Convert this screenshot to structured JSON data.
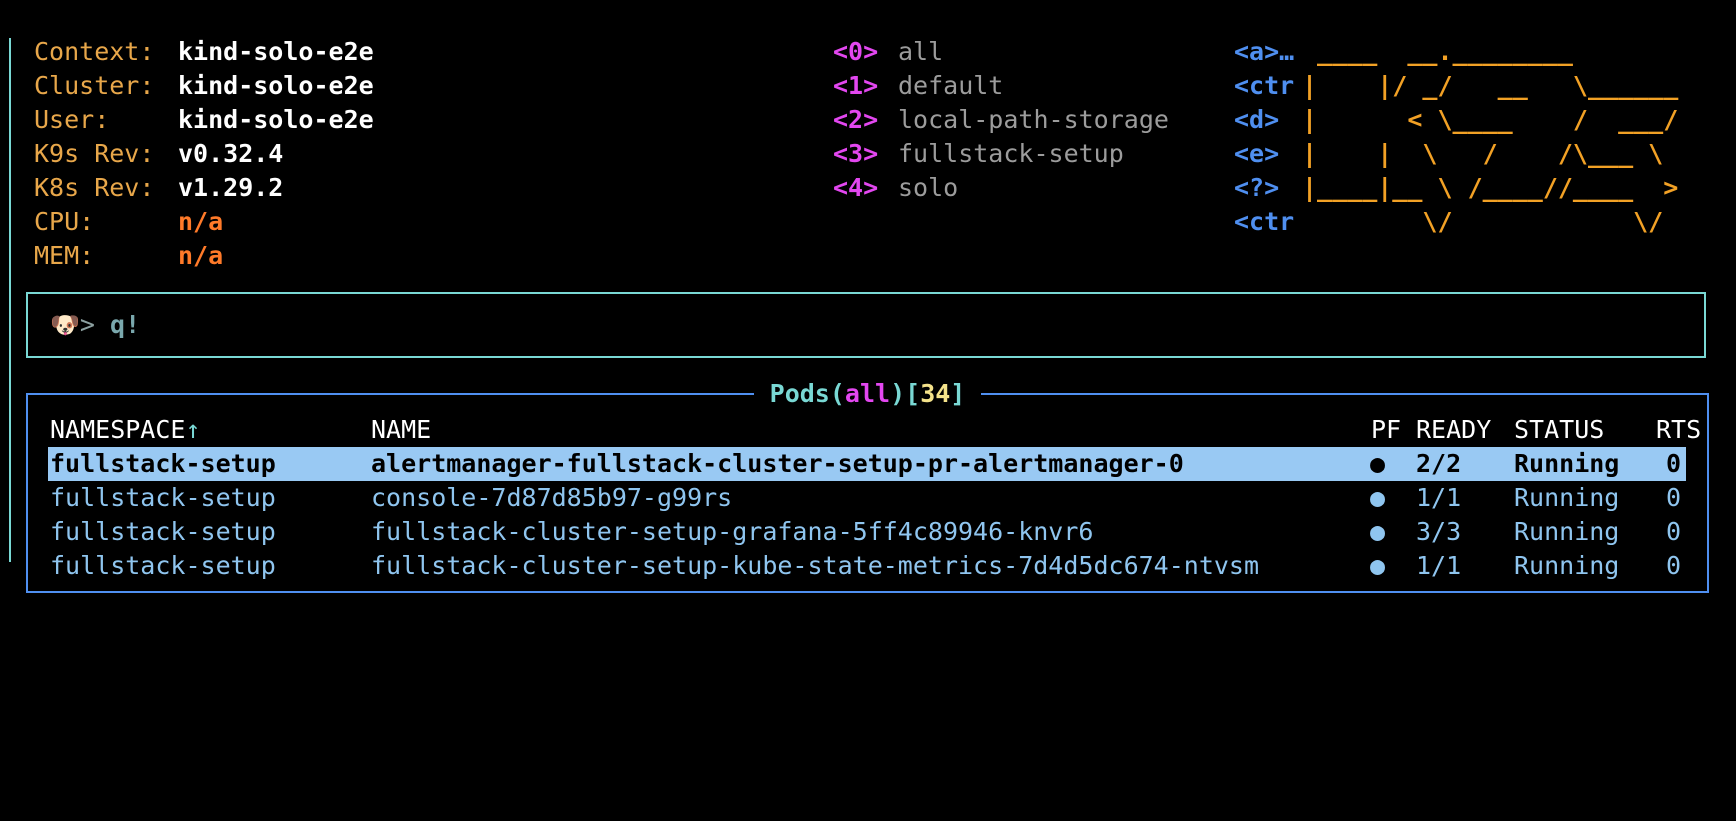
{
  "info": [
    {
      "key": "Context:",
      "value": "kind-solo-e2e"
    },
    {
      "key": "Cluster:",
      "value": "kind-solo-e2e"
    },
    {
      "key": "User:",
      "value": "kind-solo-e2e"
    },
    {
      "key": "K9s Rev:",
      "value": "v0.32.4"
    },
    {
      "key": "K8s Rev:",
      "value": "v1.29.2"
    },
    {
      "key": "CPU:",
      "value": "n/a"
    },
    {
      "key": "MEM:",
      "value": "n/a"
    }
  ],
  "namespaces": [
    {
      "key": "<0>",
      "label": "all"
    },
    {
      "key": "<1>",
      "label": "default"
    },
    {
      "key": "<2>",
      "label": "local-path-storage"
    },
    {
      "key": "<3>",
      "label": "fullstack-setup"
    },
    {
      "key": "<4>",
      "label": "solo"
    }
  ],
  "hotkeys": [
    "<a>…",
    "<ctr",
    "<d>",
    "<e>",
    "<?>",
    "<ctr"
  ],
  "logo_lines": [
    " ____  __.________",
    "|    |/ _/   __   \\______",
    "|      < \\____    /  ___/",
    "|    |  \\   /    /\\___ \\",
    "|____|__ \\ /____//____  >",
    "        \\/            \\/"
  ],
  "command": {
    "prompt": ">",
    "text": "q!"
  },
  "pods": {
    "title": "Pods",
    "namespace": "all",
    "count": "34",
    "columns": {
      "namespace": "NAMESPACE",
      "sort_arrow": "↑",
      "name": "NAME",
      "pf": "PF",
      "ready": "READY",
      "status": "STATUS",
      "rts": "RTS"
    },
    "rows": [
      {
        "namespace": "fullstack-setup",
        "name": "alertmanager-fullstack-cluster-setup-pr-alertmanager-0",
        "pf": "●",
        "ready": "2/2",
        "status": "Running",
        "rts": "0"
      },
      {
        "namespace": "fullstack-setup",
        "name": "console-7d87d85b97-g99rs",
        "pf": "●",
        "ready": "1/1",
        "status": "Running",
        "rts": "0"
      },
      {
        "namespace": "fullstack-setup",
        "name": "fullstack-cluster-setup-grafana-5ff4c89946-knvr6",
        "pf": "●",
        "ready": "3/3",
        "status": "Running",
        "rts": "0"
      },
      {
        "namespace": "fullstack-setup",
        "name": "fullstack-cluster-setup-kube-state-metrics-7d4d5dc674-ntvsm",
        "pf": "●",
        "ready": "1/1",
        "status": "Running",
        "rts": "0"
      }
    ]
  }
}
